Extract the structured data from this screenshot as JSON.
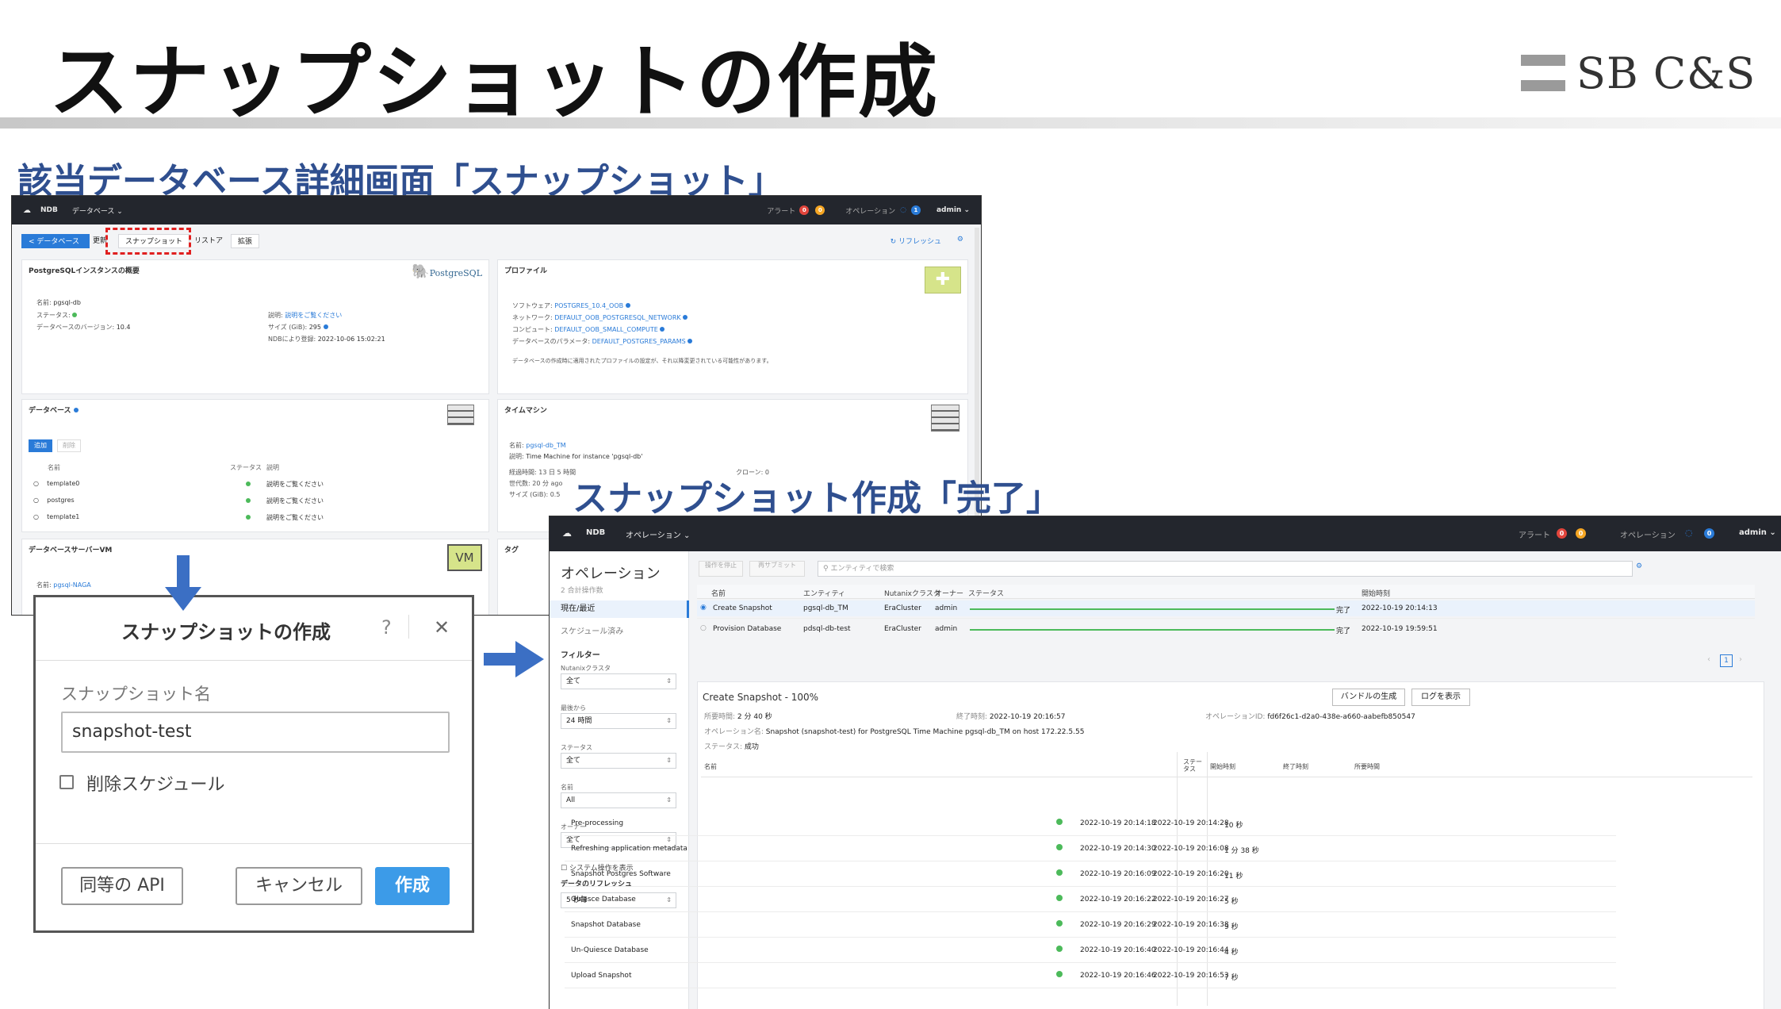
{
  "slide": {
    "title": "スナップショットの作成",
    "logo_text": "SB C&S",
    "section1": "該当データベース詳細画面「スナップショット」",
    "section2": "スナップショット作成「完了」"
  },
  "win1": {
    "brand": "NDB",
    "menu": "データベース ⌄",
    "alerts_label": "アラート",
    "alerts_red": "0",
    "alerts_orange": "0",
    "ops_label": "オペレーション",
    "ops_count": "1",
    "user": "admin ⌄",
    "back_button": "< データベース",
    "tabs": [
      "更新",
      "スナップショット",
      "リストア",
      "拡張"
    ],
    "refresh": "↻ リフレッシュ",
    "summary": {
      "title": "PostgreSQLインスタンスの概要",
      "logo": "PostgreSQL",
      "name_label": "名前:",
      "name": "pgsql-db",
      "status_label": "ステータス:",
      "version_label": "データベースのバージョン:",
      "version": "10.4",
      "desc_label": "説明:",
      "desc": "説明をご覧ください",
      "size_label": "サイズ (GiB):",
      "size": "295",
      "created_label": "NDBにより登録:",
      "created": "2022-10-06 15:02:21"
    },
    "profile": {
      "title": "プロファイル",
      "rows": [
        {
          "label": "ソフトウェア:",
          "value": "POSTGRES_10.4_OOB"
        },
        {
          "label": "ネットワーク:",
          "value": "DEFAULT_OOB_POSTGRESQL_NETWORK"
        },
        {
          "label": "コンピュート:",
          "value": "DEFAULT_OOB_SMALL_COMPUTE"
        },
        {
          "label": "データベースのパラメータ:",
          "value": "DEFAULT_POSTGRES_PARAMS"
        }
      ],
      "note": "データベースの作成時に適用されたプロファイルの設定が、それ以降変更されている可能性があります。"
    },
    "databases": {
      "title": "データベース",
      "add": "追加",
      "delete": "削除",
      "col_name": "名前",
      "col_status": "ステータス",
      "col_desc": "説明",
      "rows": [
        {
          "name": "template0",
          "desc": "説明をご覧ください"
        },
        {
          "name": "postgres",
          "desc": "説明をご覧ください"
        },
        {
          "name": "template1",
          "desc": "説明をご覧ください"
        }
      ]
    },
    "timemachine": {
      "title": "タイムマシン",
      "name_label": "名前:",
      "name": "pgsql-db_TM",
      "desc_label": "説明:",
      "desc": "Time Machine for instance 'pgsql-db'",
      "lines": [
        "経過時間: 13 日 5 時間",
        "世代数: 20 分 ago",
        "サイズ (GiB): 0.5"
      ],
      "clone": "クローン: 0"
    },
    "vm": {
      "title": "データベースサーバーVM",
      "name_label": "名前:",
      "name": "pgsql-NAGA",
      "badge": "VM"
    },
    "tags_title": "タグ"
  },
  "dialog": {
    "title": "スナップショットの作成",
    "help": "?",
    "close": "✕",
    "field_label": "スナップショット名",
    "field_value": "snapshot-test",
    "checkbox_label": "削除スケジュール",
    "api_button": "同等の API",
    "cancel_button": "キャンセル",
    "create_button": "作成"
  },
  "win2": {
    "brand": "NDB",
    "menu": "オペレーション ⌄",
    "alerts_label": "アラート",
    "alerts_red": "0",
    "alerts_orange": "0",
    "ops_label": "オペレーション",
    "ops_count": "0",
    "user": "admin ⌄",
    "side": {
      "title": "オペレーション",
      "count": "2 合計操作数",
      "current": "現在/最近",
      "scheduled": "スケジュール済み",
      "filter": "フィルター",
      "cluster_label": "Nutanixクラスタ",
      "cluster_value": "全て",
      "recent_label": "最後から",
      "recent_value": "24 時間",
      "status_label": "ステータス",
      "status_value": "全て",
      "name_label": "名前",
      "name_value": "All",
      "owner_label": "オーナー",
      "owner_value": "全て",
      "system_ops": "システム操作を表示",
      "refresh_label": "データのリフレッシュ",
      "refresh_value": "5 秒毎"
    },
    "abort_button": "操作を停止",
    "resubmit_button": "再サブミット",
    "search_placeholder": "エンティティで検索",
    "headers": [
      "名前",
      "エンティティ",
      "Nutanixクラスタ",
      "オーナー",
      "ステータス",
      "開始時刻"
    ],
    "ops": [
      {
        "name": "Create Snapshot",
        "entity": "pgsql-db_TM",
        "cluster": "EraCluster",
        "owner": "admin",
        "status": "完了",
        "progress": 100,
        "start": "2022-10-19 20:14:13"
      },
      {
        "name": "Provision Database",
        "entity": "pdsql-db-test",
        "cluster": "EraCluster",
        "owner": "admin",
        "status": "完了",
        "progress": 100,
        "start": "2022-10-19 19:59:51"
      }
    ],
    "page": "1",
    "detail": {
      "title": "Create Snapshot - 100%",
      "bundle_button": "バンドルの生成",
      "log_button": "ログを表示",
      "duration_label": "所要時間:",
      "duration": "2 分 40 秒",
      "end_label": "終了時刻:",
      "end": "2022-10-19 20:16:57",
      "opid_label": "オペレーションID:",
      "opid": "fd6f26c1-d2a0-438e-a660-aabefb850547",
      "opname_label": "オペレーション名:",
      "opname": "Snapshot (snapshot-test) for PostgreSQL Time Machine pgsql-db_TM on host 172.22.5.55",
      "status_label": "ステータス:",
      "status": "成功",
      "headers": [
        "名前",
        "ステータス",
        "開始時刻",
        "終了時刻",
        "所要時間"
      ],
      "steps": [
        {
          "name": "Pre-processing",
          "start": "2022-10-19 20:14:18",
          "end": "2022-10-19 20:14:28",
          "dur": "10 秒"
        },
        {
          "name": "Refreshing application metadata",
          "start": "2022-10-19 20:14:30",
          "end": "2022-10-19 20:16:08",
          "dur": "1 分 38 秒"
        },
        {
          "name": "Snapshot Postgres Software",
          "start": "2022-10-19 20:16:09",
          "end": "2022-10-19 20:16:20",
          "dur": "11 秒"
        },
        {
          "name": "Quiesce Database",
          "start": "2022-10-19 20:16:22",
          "end": "2022-10-19 20:16:27",
          "dur": "5 秒"
        },
        {
          "name": "Snapshot Database",
          "start": "2022-10-19 20:16:29",
          "end": "2022-10-19 20:16:38",
          "dur": "9 秒"
        },
        {
          "name": "Un-Quiesce Database",
          "start": "2022-10-19 20:16:40",
          "end": "2022-10-19 20:16:44",
          "dur": "4 秒"
        },
        {
          "name": "Upload Snapshot",
          "start": "2022-10-19 20:16:46",
          "end": "2022-10-19 20:16:53",
          "dur": "7 秒"
        }
      ]
    }
  },
  "colors": {
    "accent": "#2a7bd8",
    "section": "#2f4f8f",
    "success": "#4cba5a",
    "alert": "#e2453c",
    "warn": "#f5a623",
    "arrow": "#3b6fc4"
  }
}
